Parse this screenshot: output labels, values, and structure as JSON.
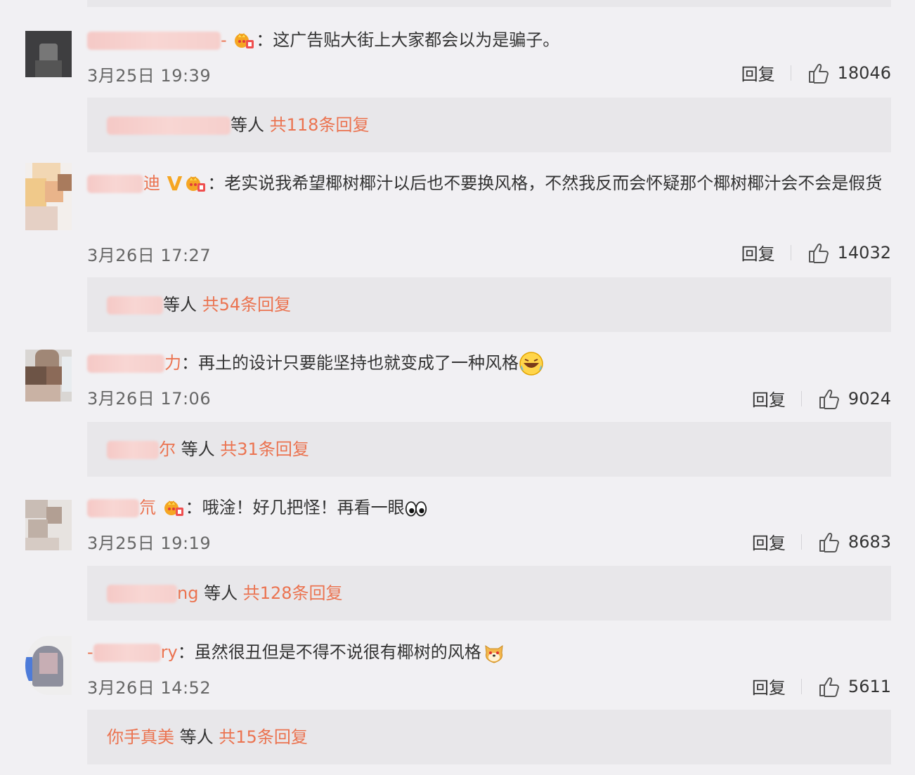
{
  "comments": [
    {
      "text": "：这广告贴大街上大家都会以为是骗子。",
      "time": "3月25日 19:39",
      "reply_label": "回复",
      "likes": "18046",
      "reply_summary": {
        "name_tail": "等人",
        "count_text": "共118条回复"
      }
    },
    {
      "name_tail": "迪",
      "text": "：老实说我希望椰树椰汁以后也不要换风格，不然我反而会怀疑那个椰树椰汁会不会是假货",
      "time": "3月26日 17:27",
      "reply_label": "回复",
      "likes": "14032",
      "reply_summary": {
        "name_tail": "等人",
        "count_text": "共54条回复"
      }
    },
    {
      "name_tail": "力",
      "text": "：再土的设计只要能坚持也就变成了一种风格",
      "time": "3月26日 17:06",
      "reply_label": "回复",
      "likes": "9024",
      "reply_summary": {
        "name_tail": "尔 ",
        "suffix": "等人",
        "count_text": "共31条回复"
      }
    },
    {
      "name_tail": "氘",
      "text": "：哦淦！好几把怪！再看一眼",
      "time": "3月25日 19:19",
      "reply_label": "回复",
      "likes": "8683",
      "reply_summary": {
        "name_tail": "ng ",
        "suffix": "等人",
        "count_text": "共128条回复"
      }
    },
    {
      "name_head": "-",
      "name_tail": "ry",
      "text": "：虽然很丑但是不得不说很有椰树的风格",
      "time": "3月26日 14:52",
      "reply_label": "回复",
      "likes": "5611",
      "reply_summary": {
        "name": "你手真美",
        "suffix": "等人",
        "count_text": "共15条回复"
      }
    }
  ],
  "colors": {
    "link": "#eb7350",
    "background": "#f1f0f3",
    "reply_box": "#e8e7ea"
  },
  "icons": {
    "like": "thumbs-up-icon",
    "badge": "fan-badge-icon",
    "verified": "verified-v-icon"
  }
}
